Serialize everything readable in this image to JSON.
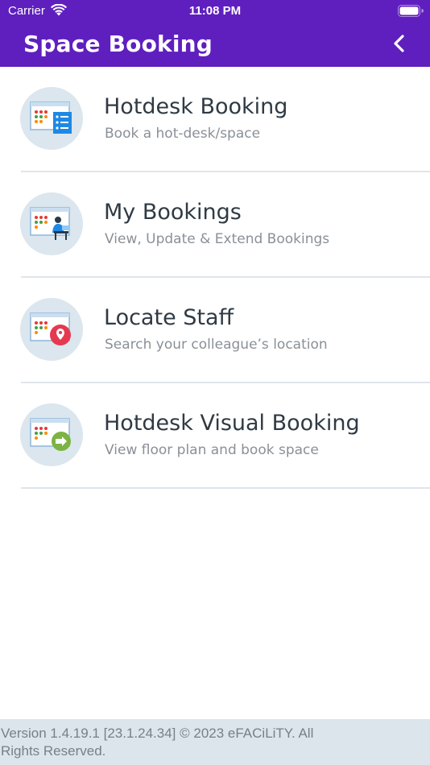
{
  "status_bar": {
    "carrier": "Carrier",
    "time": "11:08 PM"
  },
  "header": {
    "title": "Space Booking",
    "background": "#5f1fbf"
  },
  "menu": {
    "items": [
      {
        "title": "Hotdesk Booking",
        "subtitle": "Book a hot-desk/space",
        "icon": "hotdesk-booking-icon"
      },
      {
        "title": "My Bookings",
        "subtitle": "View, Update & Extend Bookings",
        "icon": "my-bookings-icon"
      },
      {
        "title": "Locate Staff",
        "subtitle": "Search your colleague’s location",
        "icon": "locate-staff-icon"
      },
      {
        "title": "Hotdesk Visual Booking",
        "subtitle": "View floor plan and book space",
        "icon": "visual-booking-icon"
      }
    ]
  },
  "footer": {
    "text": "Version 1.4.19.1 [23.1.24.34] © 2023 eFACiLiTY. All Rights Reserved."
  }
}
